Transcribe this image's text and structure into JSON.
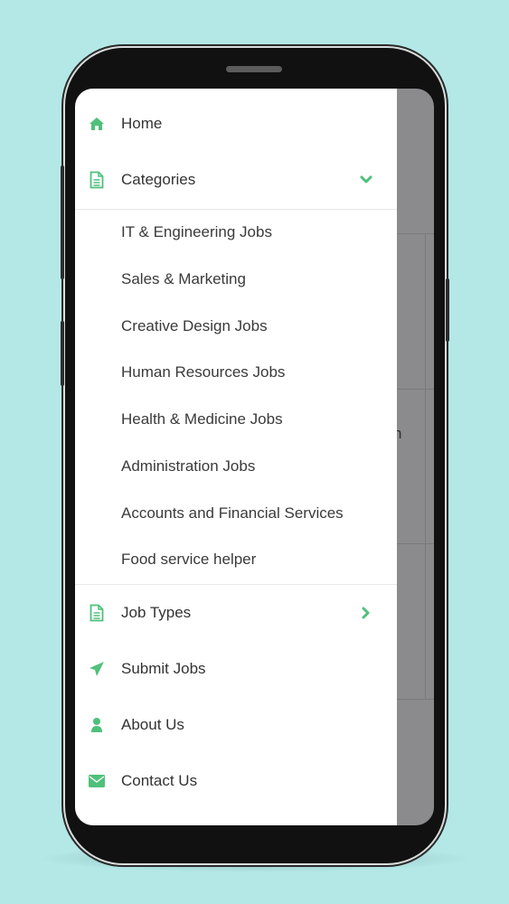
{
  "theme": {
    "accent": "#4fc07a",
    "background": "#b3e8e6",
    "overlay": "#8b8a8d"
  },
  "menu": {
    "home": {
      "label": "Home",
      "icon": "home-icon"
    },
    "categories": {
      "label": "Categories",
      "icon": "document-icon",
      "expanded": true,
      "items": [
        "IT & Engineering Jobs",
        "Sales & Marketing",
        "Creative Design Jobs",
        "Human Resources Jobs",
        "Health & Medicine Jobs",
        "Administration Jobs",
        "Accounts and Financial Services",
        "Food service helper"
      ]
    },
    "job_types": {
      "label": "Job Types",
      "icon": "document-icon"
    },
    "submit_jobs": {
      "label": "Submit Jobs",
      "icon": "paper-plane-icon"
    },
    "about_us": {
      "label": "About Us",
      "icon": "user-icon"
    },
    "contact_us": {
      "label": "Contact Us",
      "icon": "envelope-icon"
    }
  },
  "background_fragment": "n"
}
